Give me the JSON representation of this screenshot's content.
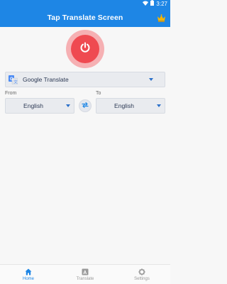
{
  "status_bar": {
    "time": "3:27",
    "wifi_icon": "wifi-icon",
    "battery_icon": "battery-icon"
  },
  "app_bar": {
    "title": "Tap Translate Screen",
    "crown_icon": "crown-icon",
    "crown_color": "#f5b400"
  },
  "power": {
    "icon": "power-icon",
    "outer_color": "#f6b0b3",
    "inner_color": "#ef4a51"
  },
  "engine": {
    "label": "Google Translate",
    "icon": "google-translate-icon"
  },
  "languages": {
    "from_label": "From",
    "to_label": "To",
    "from_value": "English",
    "to_value": "English",
    "swap_icon": "swap-icon"
  },
  "nav": {
    "items": [
      {
        "label": "Home",
        "icon": "home-icon",
        "active": true
      },
      {
        "label": "Translate",
        "icon": "translate-icon",
        "active": false
      },
      {
        "label": "Settings",
        "icon": "gear-icon",
        "active": false
      }
    ]
  },
  "colors": {
    "primary": "#1e86e5",
    "background": "#f7f7f7"
  }
}
